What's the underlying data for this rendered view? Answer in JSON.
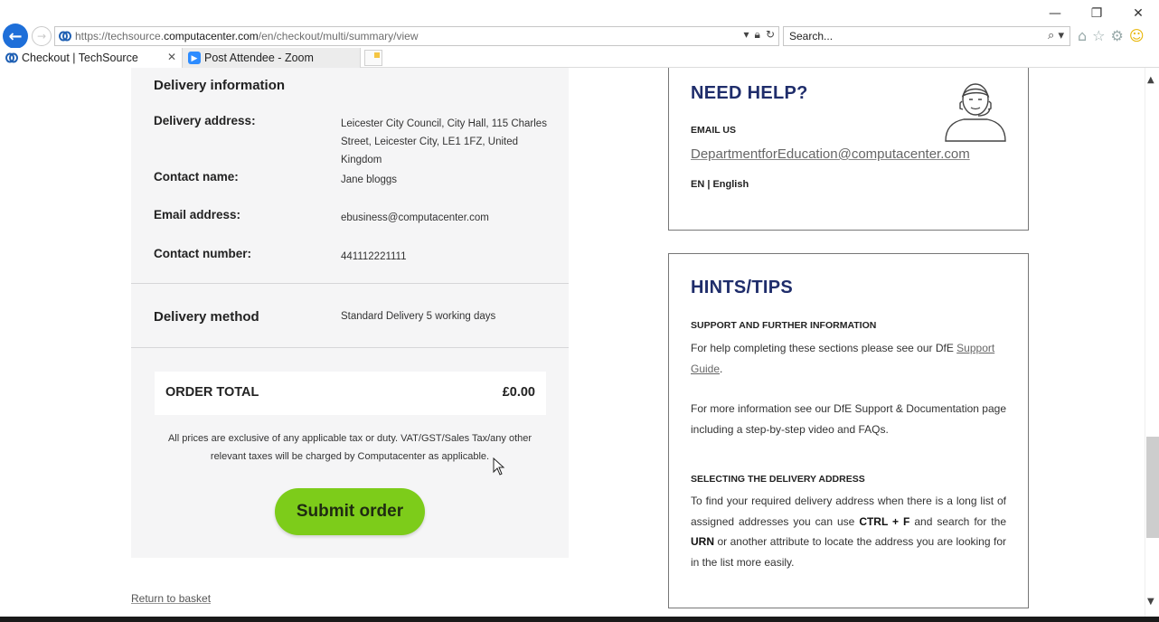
{
  "browser": {
    "url_prefix": "https://techsource.",
    "url_host": "computacenter.com",
    "url_path": "/en/checkout/multi/summary/view",
    "search_placeholder": "Search...",
    "tabs": [
      {
        "label": "Checkout | TechSource",
        "active": true
      },
      {
        "label": "Post Attendee - Zoom",
        "active": false
      }
    ]
  },
  "delivery_info": {
    "title": "Delivery information",
    "rows": [
      {
        "label": "Delivery address:",
        "value": "Leicester City Council, City Hall, 115 Charles Street, Leicester City, LE1 1FZ, United Kingdom"
      },
      {
        "label": "Contact name:",
        "value": "Jane bloggs"
      },
      {
        "label": "Email address:",
        "value": "ebusiness@computacenter.com"
      },
      {
        "label": "Contact number:",
        "value": "441112221111"
      }
    ]
  },
  "delivery_method": {
    "label": "Delivery method",
    "value": "Standard Delivery  5 working days"
  },
  "order_total": {
    "label": "ORDER TOTAL",
    "value": "£0.00"
  },
  "disclaimer": "All prices are exclusive of any applicable tax or duty. VAT/GST/Sales Tax/any other relevant taxes will be charged by Computacenter as applicable.",
  "submit_label": "Submit order",
  "return_link": "Return to basket",
  "help": {
    "heading": "NEED HELP?",
    "email_label": "EMAIL US",
    "email": "DepartmentforEducation@computacenter.com",
    "language": "EN | English"
  },
  "hints": {
    "heading": "HINTS/TIPS",
    "support_heading": "SUPPORT AND FURTHER INFORMATION",
    "support_text_1": "For help completing these sections please see our DfE ",
    "support_link": "Support Guide",
    "support_text_1_end": ".",
    "support_text_2": "For more information see our DfE Support & Documentation page including a step-by-step video and FAQs.",
    "address_heading": "SELECTING THE DELIVERY ADDRESS",
    "address_text_a": "To find your required delivery address when there is a long list of assigned addresses you can use ",
    "address_key": "CTRL + F",
    "address_text_b": " and search for the ",
    "address_urn": "URN",
    "address_text_c": " or another attribute to locate the address you are looking for in the list more easily."
  }
}
